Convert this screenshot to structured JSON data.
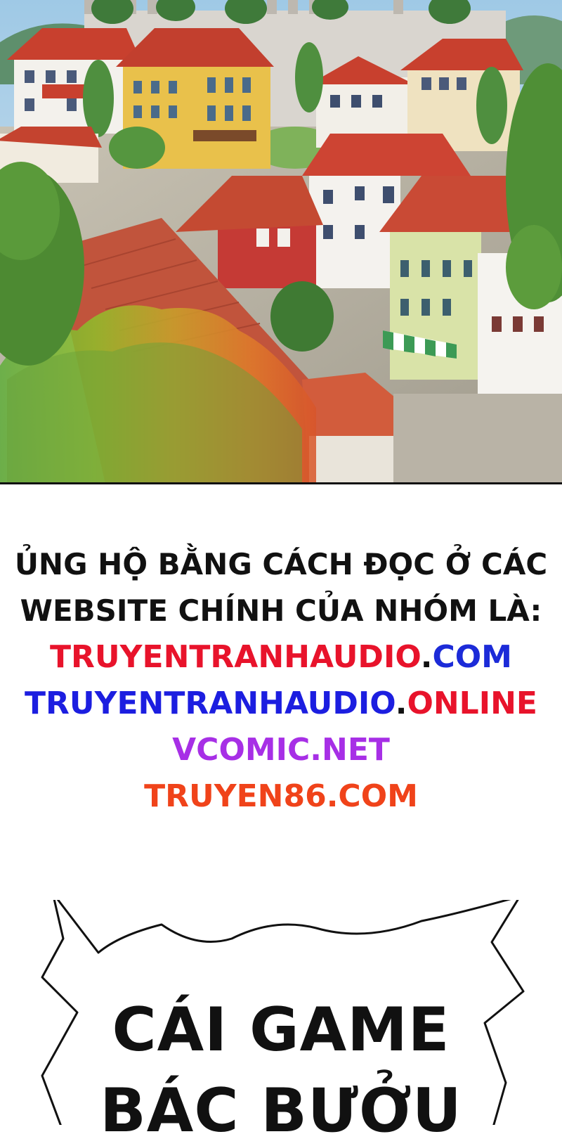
{
  "notice": {
    "line1": "ỦNG HỘ BẰNG CÁCH ĐỌC Ở CÁC",
    "line2": "WEBSITE CHÍNH CỦA NHÓM LÀ:",
    "site1": {
      "name": "TRUYENTRANHAUDIO",
      "dot": ".",
      "tld": "COM",
      "name_color": "#e8132b",
      "tld_color": "#1c2bd8"
    },
    "site2": {
      "name": "TRUYENTRANHAUDIO",
      "dot": ".",
      "tld": "ONLINE",
      "name_color": "#1c1ee0",
      "tld_color": "#e8132b"
    },
    "site3": {
      "text": "VCOMIC.NET",
      "color": "#a72fe6"
    },
    "site4": {
      "text": "TRUYEN86.COM",
      "color": "#f0431a"
    }
  },
  "speech_bubble": {
    "line1": "CÁI GAME",
    "line2": "BÁC BƯỞU"
  }
}
